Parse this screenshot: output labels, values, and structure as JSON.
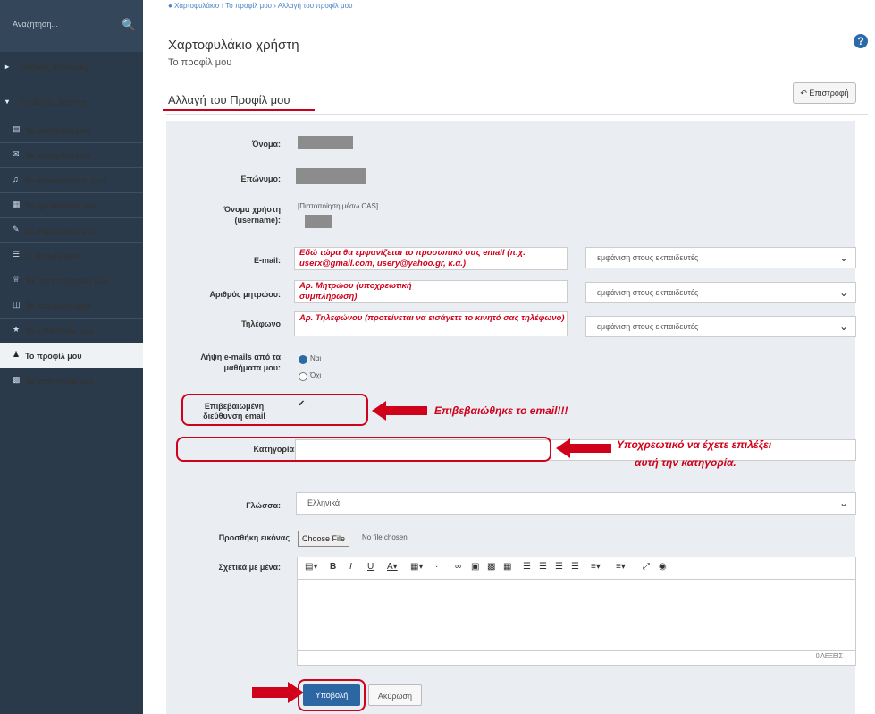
{
  "sidebar": {
    "search_placeholder": "Αναζήτηση...",
    "groups": [
      "Βασικές Επιλογές",
      "Επιλογές Χρήστη"
    ],
    "items": [
      {
        "label": "Τα μαθήματά μου",
        "icon": "book-icon"
      },
      {
        "label": "Τα μηνύματά μου",
        "icon": "envelope-icon"
      },
      {
        "label": "Οι ανακοινώσεις μου",
        "icon": "megaphone-icon"
      },
      {
        "label": "Το ημερολόγιό μου",
        "icon": "calendar-icon"
      },
      {
        "label": "Οι σημειώσεις μου",
        "icon": "edit-icon"
      },
      {
        "label": "Οι βαθμοί μου",
        "icon": "grades-icon"
      },
      {
        "label": "Τα πιστοποιητικά μου",
        "icon": "trophy-icon"
      },
      {
        "label": "Το ιστολόγιό μου",
        "icon": "blog-icon"
      },
      {
        "label": "Το e-Portfolio μου",
        "icon": "star-icon"
      },
      {
        "label": "Το προφίλ μου",
        "icon": "user-icon"
      },
      {
        "label": "Τα στατιστικά μου",
        "icon": "chart-icon"
      }
    ]
  },
  "breadcrumb": "● Χαρτοφυλάκιο  ›  Το προφίλ μου  ›  Αλλαγή του προφίλ μου",
  "header": {
    "title": "Χαρτοφυλάκιο χρήστη",
    "subtitle": "Το προφίλ μου",
    "section_title": "Αλλαγή του Προφίλ μου",
    "back_label": "Επιστροφή"
  },
  "form": {
    "name_label": "Όνομα:",
    "surname_label": "Επώνυμο:",
    "username_label": "Όνομα χρήστη (username):",
    "username_note": "[Πιστοποίηση μέσω CAS]",
    "email_label": "E-mail:",
    "am_label": "Αριθμός μητρώου:",
    "phone_label": "Τηλέφωνο",
    "receive_label": "Λήψη e-mails από τα μαθήματα μου:",
    "radio_yes": "Ναι",
    "radio_no": "Όχι",
    "verified_label": "Επιβεβαιωμένη διεύθυνση email",
    "verified_mark": "✔",
    "category_label": "Κατηγορία:",
    "language_label": "Γλώσσα:",
    "language_value": "Ελληνικά",
    "image_label": "Προσθήκη εικόνας",
    "file_button": "Choose File",
    "file_status": "No file chosen",
    "about_label": "Σχετικά με μένα:",
    "visibility": "εμφάνιση στους εκπαιδευτές",
    "submit": "Υποβολή",
    "cancel": "Ακύρωση"
  },
  "notes": {
    "email_note": "Εδώ τώρα θα εμφανίζεται το προσωπικό σας email (π.χ. userx@gmail.com, usery@yahoo.gr, κ.α.)",
    "am_note": "Αρ. Μητρώου (υποχρεωτική συμπλήρωση)",
    "phone_note": "Αρ. Τηλεφώνου (προτείνεται να εισάγετε το κινητό σας τηλέφωνο)",
    "verified_note": "Επιβεβαιώθηκε το email!!!",
    "category_note_1": "Υποχρεωτικό να έχετε επιλέξει",
    "category_note_2": "αυτή την κατηγορία."
  },
  "editor": {
    "footer": "0 ΛΕΞΕΙΣ"
  },
  "colors": {
    "sidebar_bg": "#2b3a4a",
    "accent_red": "#d0021b",
    "primary_button": "#2c67a3"
  }
}
